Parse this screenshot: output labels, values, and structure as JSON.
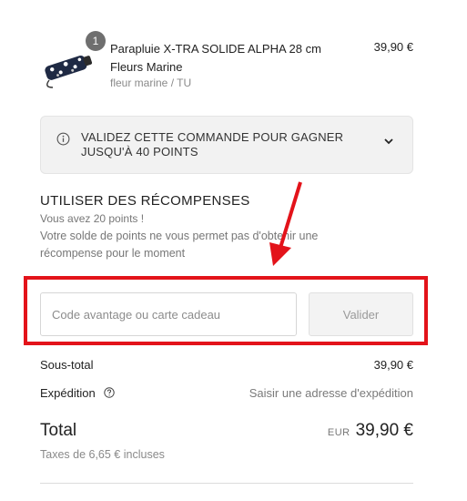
{
  "product": {
    "quantity": "1",
    "name": "Parapluie X-TRA SOLIDE ALPHA 28 cm Fleurs Marine",
    "variant": "fleur marine / TU",
    "price": "39,90 €",
    "image_icon": "umbrella-thumbnail"
  },
  "points_banner": {
    "text": "VALIDEZ CETTE COMMANDE POUR GAGNER JUSQU'À 40 POINTS",
    "icon": "info-icon",
    "toggle_icon": "chevron-down-icon"
  },
  "rewards": {
    "title": "UTILISER DES RÉCOMPENSES",
    "points": "Vous avez 20 points !",
    "message": "Votre solde de points ne vous permet pas d'obtenir une récompense pour le moment"
  },
  "discount": {
    "placeholder": "Code avantage ou carte cadeau",
    "value": "",
    "button": "Valider"
  },
  "summary": {
    "subtotal_label": "Sous-total",
    "subtotal_value": "39,90 €",
    "shipping_label": "Expédition",
    "shipping_value": "Saisir une adresse d'expédition",
    "total_label": "Total",
    "currency": "EUR",
    "total_value": "39,90 €",
    "taxes": "Taxes de 6,65 € incluses"
  },
  "colors": {
    "annotation": "#e3131a",
    "badge": "#6f6f6f",
    "banner_bg": "#f2f2f2"
  }
}
